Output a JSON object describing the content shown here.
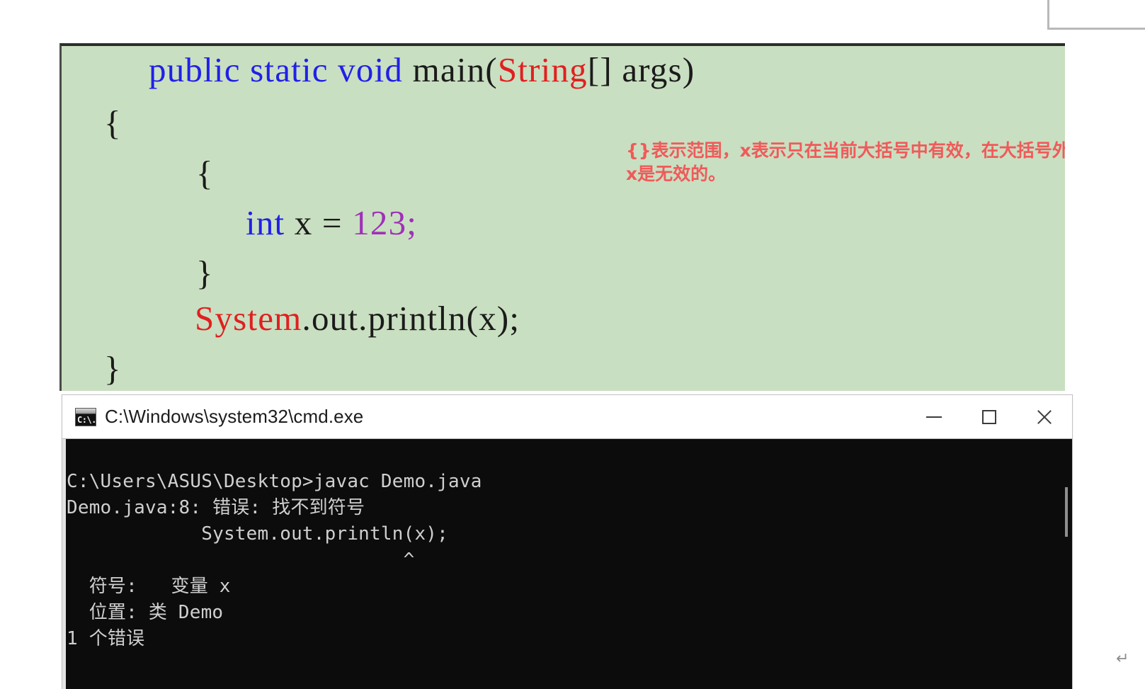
{
  "document": {
    "paragraph_mark": "↵"
  },
  "code_image": {
    "background_color": "#c9dfc1",
    "lines": [
      {
        "id": "ln-1",
        "segments": [
          {
            "text": "public static void ",
            "type": "keyword"
          },
          {
            "text": "main(",
            "type": "plain"
          },
          {
            "text": "String",
            "type": "type"
          },
          {
            "text": "[] args)",
            "type": "plain"
          }
        ]
      },
      {
        "id": "ln-2",
        "segments": [
          {
            "text": "{",
            "type": "plain"
          }
        ]
      },
      {
        "id": "ln-3",
        "segments": [
          {
            "text": "{",
            "type": "plain"
          }
        ]
      },
      {
        "id": "ln-4",
        "segments": [
          {
            "text": "int",
            "type": "keyword"
          },
          {
            "text": " x = ",
            "type": "plain"
          },
          {
            "text": "123",
            "type": "number"
          },
          {
            "text": ";",
            "type": "number"
          }
        ]
      },
      {
        "id": "ln-5",
        "segments": [
          {
            "text": "}",
            "type": "plain"
          }
        ]
      },
      {
        "id": "ln-6",
        "segments": [
          {
            "text": "System",
            "type": "type"
          },
          {
            "text": ".out.println(x);",
            "type": "plain"
          }
        ]
      },
      {
        "id": "ln-7",
        "segments": [
          {
            "text": "}",
            "type": "plain"
          }
        ]
      },
      {
        "id": "ln-8",
        "segments": [
          {
            "text": "}",
            "type": "plain"
          }
        ]
      }
    ],
    "annotation": {
      "text": "{}表示范围，x表示只在当前大括号中有效，在大括号外x是无效的。",
      "color": "#f05a5a"
    }
  },
  "cmd_window": {
    "title": "C:\\Windows\\system32\\cmd.exe",
    "icon_name": "cmd-icon",
    "buttons": {
      "minimize": "minimize",
      "maximize": "maximize",
      "close": "close"
    },
    "console": {
      "background_color": "#0c0c0c",
      "foreground_color": "#cfcfcf",
      "lines": [
        "C:\\Users\\ASUS\\Desktop>javac Demo.java",
        "Demo.java:8: 错误: 找不到符号",
        "            System.out.println(x);",
        "                              ^",
        "  符号:   变量 x",
        "  位置: 类 Demo",
        "1 个错误"
      ],
      "text": "C:\\Users\\ASUS\\Desktop>javac Demo.java\nDemo.java:8: 错误: 找不到符号\n            System.out.println(x);\n                              ^\n  符号:   变量 x\n  位置: 类 Demo\n1 个错误"
    }
  }
}
